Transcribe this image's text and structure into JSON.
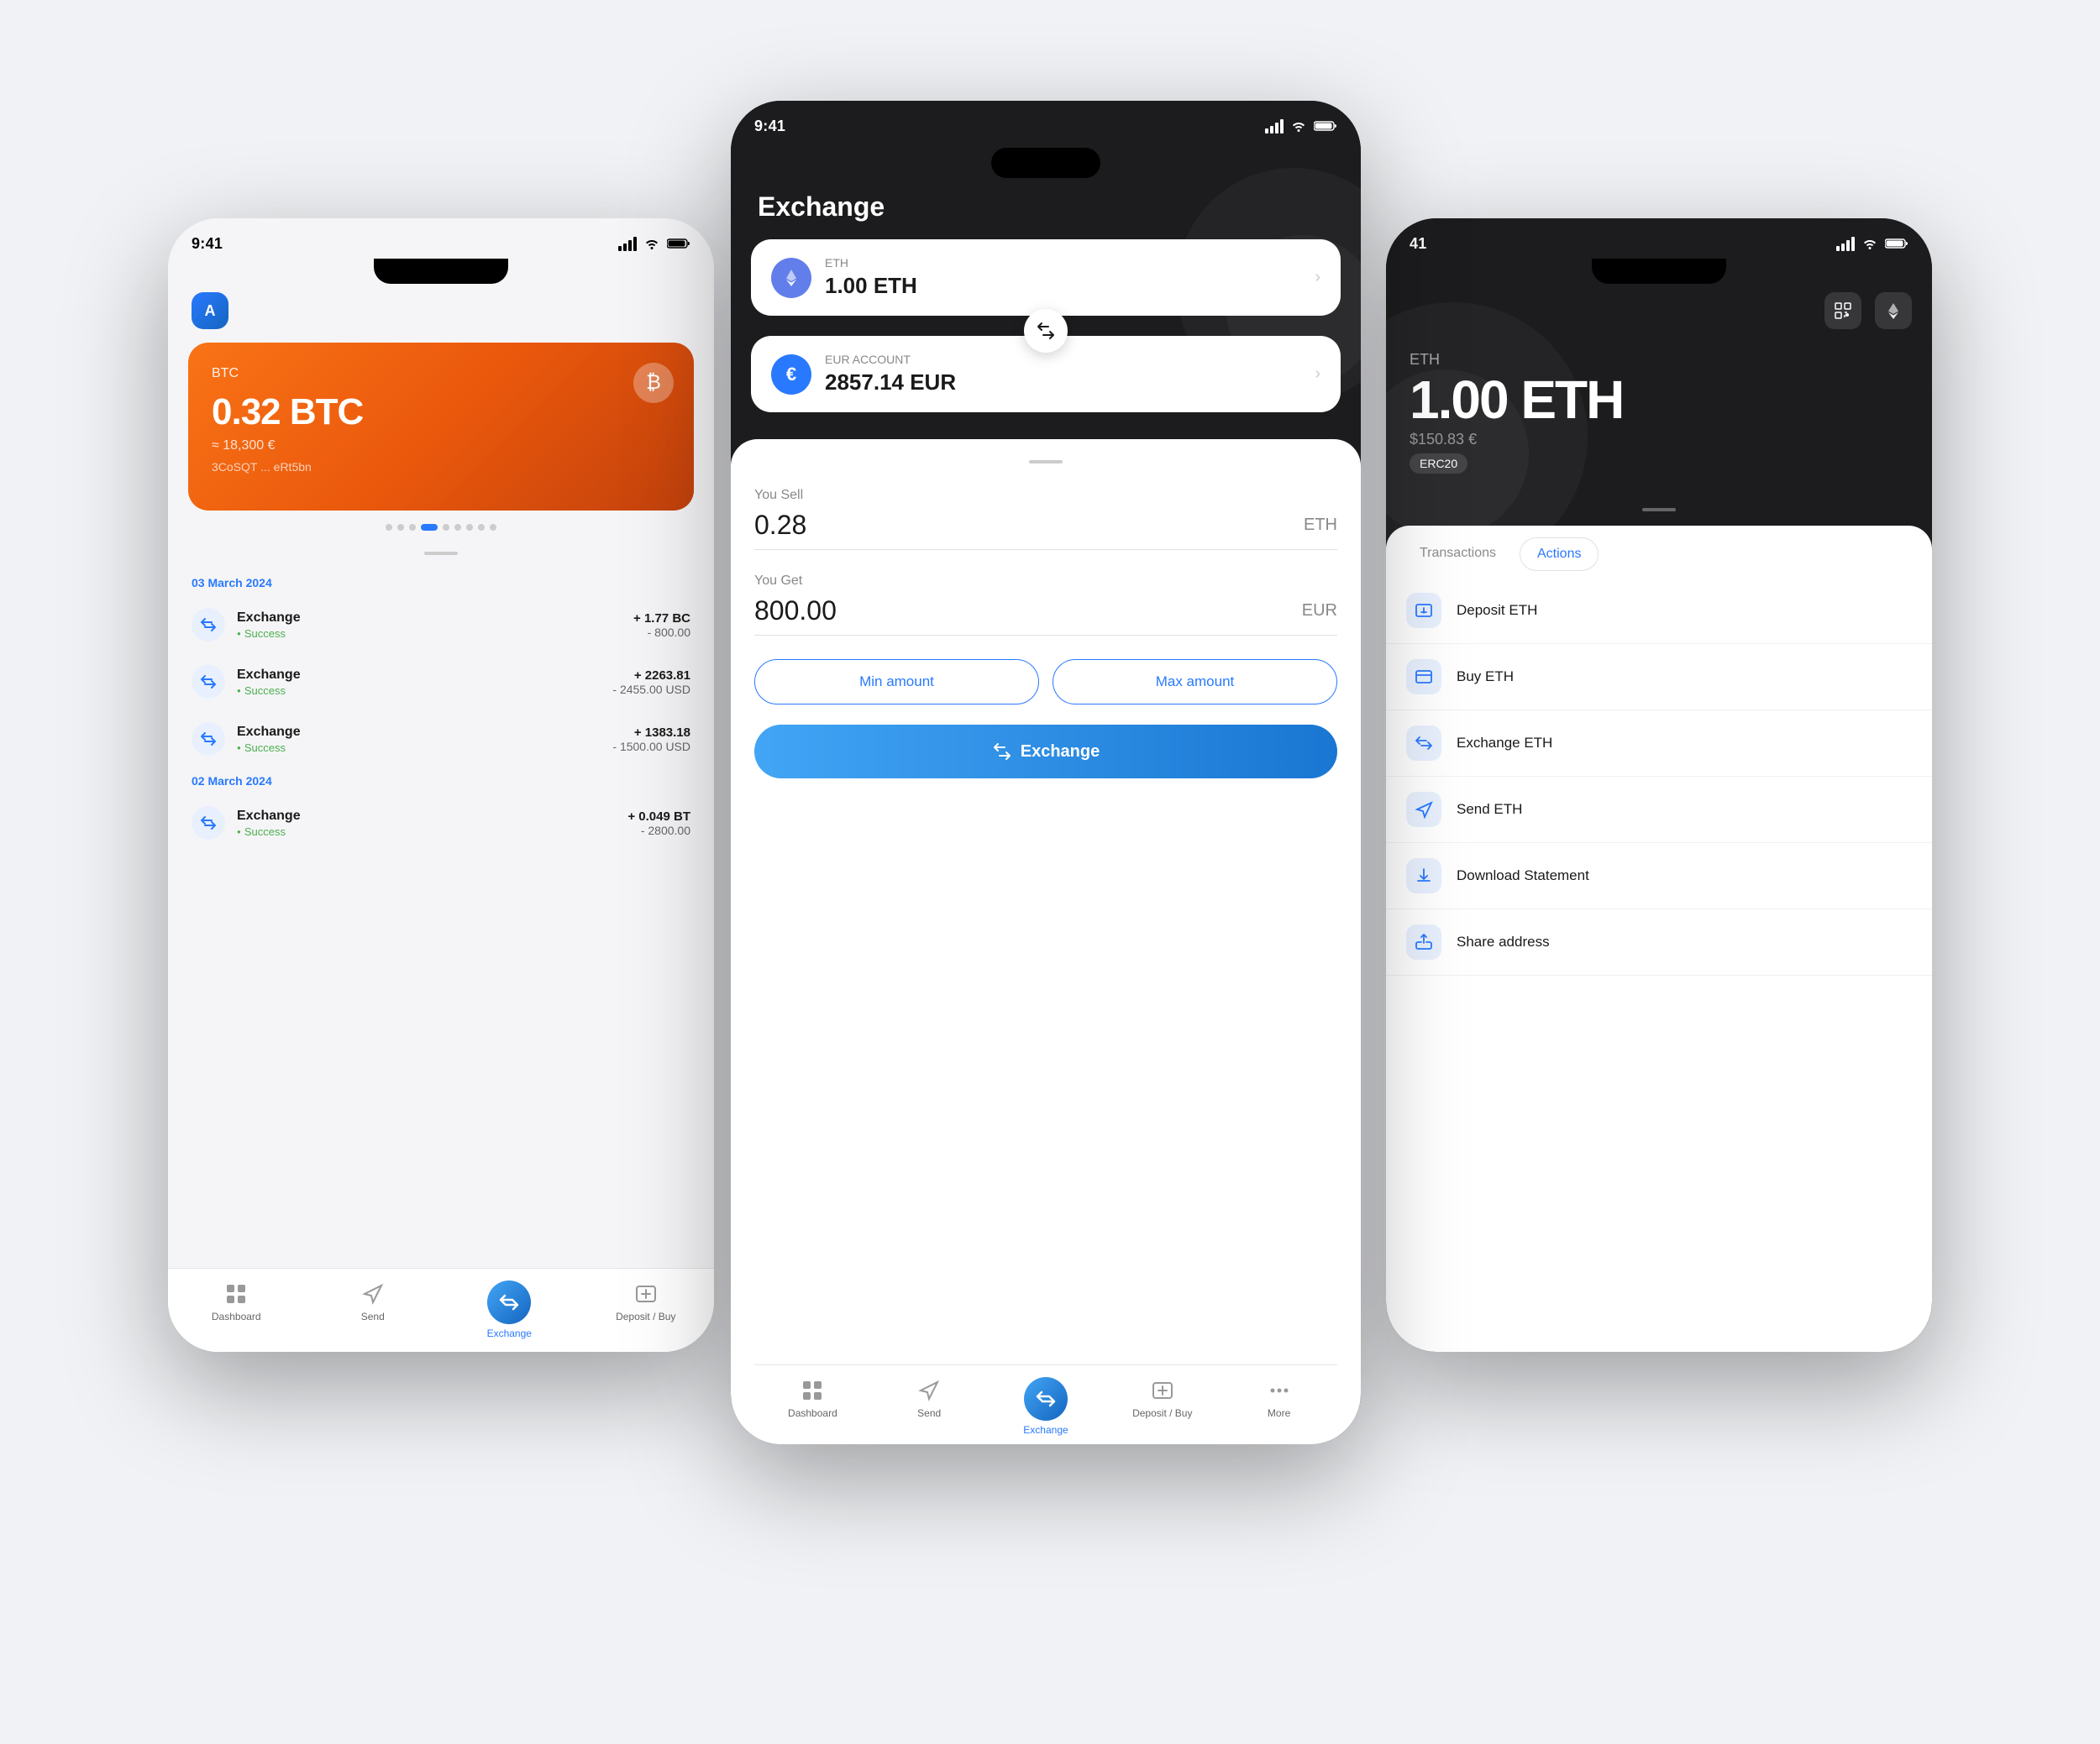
{
  "scene": {
    "bg_color": "#e8eaf0"
  },
  "left_phone": {
    "status_time": "9:41",
    "card": {
      "ticker": "BTC",
      "amount": "0.32 BTC",
      "fiat": "≈ 18,300 €",
      "address": "3CoSQT ... eRt5bn",
      "icon": "₿"
    },
    "transactions": [
      {
        "date": "03 March 2024",
        "items": [
          {
            "type": "Exchange",
            "status": "Success",
            "plus": "+ 1.77 BC",
            "minus": "- 800.00"
          },
          {
            "type": "Exchange",
            "status": "Success",
            "plus": "+ 2263.81",
            "minus": "- 2455.00 USD"
          },
          {
            "type": "Exchange",
            "status": "Success",
            "plus": "+ 1383.18",
            "minus": "- 1500.00 USD"
          }
        ]
      },
      {
        "date": "02 March 2024",
        "items": [
          {
            "type": "Exchange",
            "status": "Success",
            "plus": "+ 0.049 BT",
            "minus": "- 2800.00"
          }
        ]
      }
    ],
    "nav": [
      {
        "label": "Dashboard",
        "active": false
      },
      {
        "label": "Send",
        "active": false
      },
      {
        "label": "Exchange",
        "active": true
      },
      {
        "label": "Deposit / Buy",
        "active": false
      }
    ]
  },
  "center_phone": {
    "status_time": "9:41",
    "title": "Exchange",
    "from": {
      "ticker": "ETH",
      "amount": "1.00 ETH"
    },
    "to": {
      "ticker": "EUR ACCOUNT",
      "amount": "2857.14 EUR"
    },
    "sell_label": "You Sell",
    "sell_value": "0.28",
    "sell_currency": "ETH",
    "get_label": "You Get",
    "get_value": "800.00",
    "get_currency": "EUR",
    "min_btn": "Min amount",
    "max_btn": "Max amount",
    "exchange_btn": "Exchange",
    "nav": [
      {
        "label": "Dashboard",
        "active": false
      },
      {
        "label": "Send",
        "active": false
      },
      {
        "label": "Exchange",
        "active": true
      },
      {
        "label": "Deposit / Buy",
        "active": false
      },
      {
        "label": "More",
        "active": false
      }
    ]
  },
  "right_phone": {
    "status_time": "41",
    "ticker": "ETH",
    "amount": "1.00 ETH",
    "fiat": "$150.83 €",
    "badge": "ERC20",
    "tabs": [
      {
        "label": "Transactions",
        "active": false
      },
      {
        "label": "Actions",
        "active": true
      }
    ],
    "actions": [
      {
        "label": "Deposit ETH",
        "icon": "deposit"
      },
      {
        "label": "Buy ETH",
        "icon": "buy"
      },
      {
        "label": "Exchange ETH",
        "icon": "exchange"
      },
      {
        "label": "Send ETH",
        "icon": "send"
      },
      {
        "label": "Download Statement",
        "icon": "download"
      },
      {
        "label": "Share  address",
        "icon": "share"
      }
    ]
  }
}
